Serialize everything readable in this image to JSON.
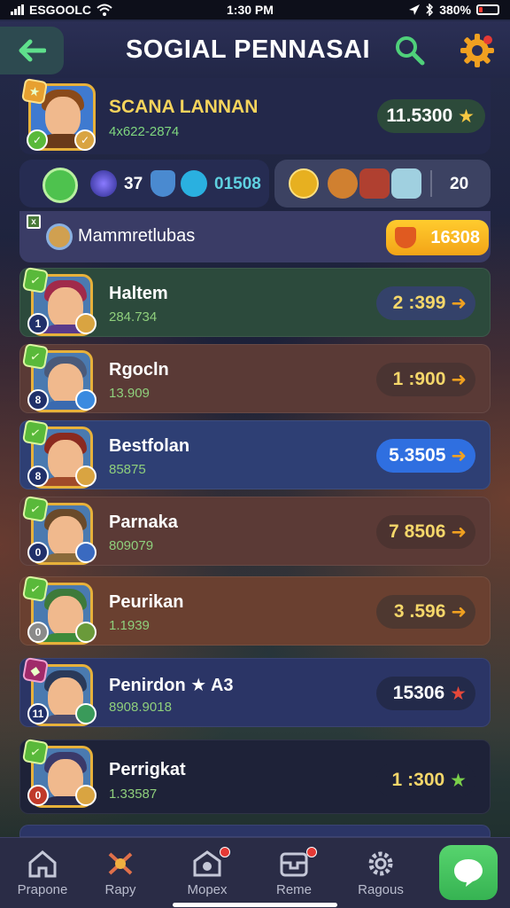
{
  "status_bar": {
    "carrier": "ESGOOLC",
    "time": "1:30 PM",
    "battery": "380%"
  },
  "header": {
    "title": "SOGIAL PENNASAI",
    "back_icon": "arrow-left-icon",
    "search_icon": "search-icon",
    "settings_icon": "gear-icon"
  },
  "profile": {
    "name": "SCANA LANNAN",
    "id": "4x622-2874",
    "score": "11.5300"
  },
  "stats": {
    "left_count": "37",
    "left_value": "01508",
    "right_value": "20"
  },
  "guild": {
    "name": "Mammretlubas",
    "value": "16308"
  },
  "players": [
    {
      "name": "Haltem",
      "sub": "284.734",
      "score_a": "2",
      "score_b": ":399",
      "bg": "#2c4a3c",
      "pill": "#34426a",
      "hair": "#a02a4a",
      "body": "#5a3a8a"
    },
    {
      "name": "Rgocln",
      "sub": "13.909",
      "score_a": "1",
      "score_b": ":900",
      "bg": "#5a3a36",
      "pill": "#4a3432",
      "hair": "#4a5a7a",
      "body": "#3a6ab0"
    },
    {
      "name": "Bestfolan",
      "sub": "85875",
      "score_a": "",
      "score_b": "5.3505",
      "bg": "#2e3f74",
      "pill": "#2f6fe0",
      "hair": "#8a2a20",
      "body": "#a04a2a"
    },
    {
      "name": "Parnaka",
      "sub": "809079",
      "score_a": "7",
      "score_b": "8506",
      "bg": "#5b3a36",
      "pill": "#4c3330",
      "hair": "#6a4a2a",
      "body": "#8a6a3a"
    },
    {
      "name": "Peurikan",
      "sub": "1.1939",
      "score_a": "3",
      "score_b": ".596",
      "bg": "#6a4030",
      "pill": "#4e3830",
      "hair": "#3e7a3a",
      "body": "#3e8a3a"
    },
    {
      "name": "Penirdon ★ A3",
      "sub": "8908.9018",
      "score_a": "",
      "score_b": "15306",
      "bg": "#2b3566",
      "pill": "#232a4a",
      "hair": "#2a3a5a",
      "body": "#4a4a6a"
    },
    {
      "name": "Perrigkat",
      "sub": "1.33587",
      "score_a": "1",
      "score_b": ":300",
      "bg": "#1e2238",
      "pill": "#1e2238",
      "hair": "#3a3a6a",
      "body": "#2a2a4a"
    }
  ],
  "tabs": [
    {
      "label": "Prapone",
      "icon": "home-icon",
      "dot": false
    },
    {
      "label": "Rapy",
      "icon": "trophy-icon",
      "dot": false
    },
    {
      "label": "Mopex",
      "icon": "shield-icon",
      "dot": true
    },
    {
      "label": "Reme",
      "icon": "inbox-icon",
      "dot": true
    },
    {
      "label": "Ragous",
      "icon": "gear-icon",
      "dot": false
    }
  ],
  "colors": {
    "accent_green": "#5fe08c",
    "gold": "#f6d45c",
    "highlight_blue": "#2f6fe0"
  }
}
